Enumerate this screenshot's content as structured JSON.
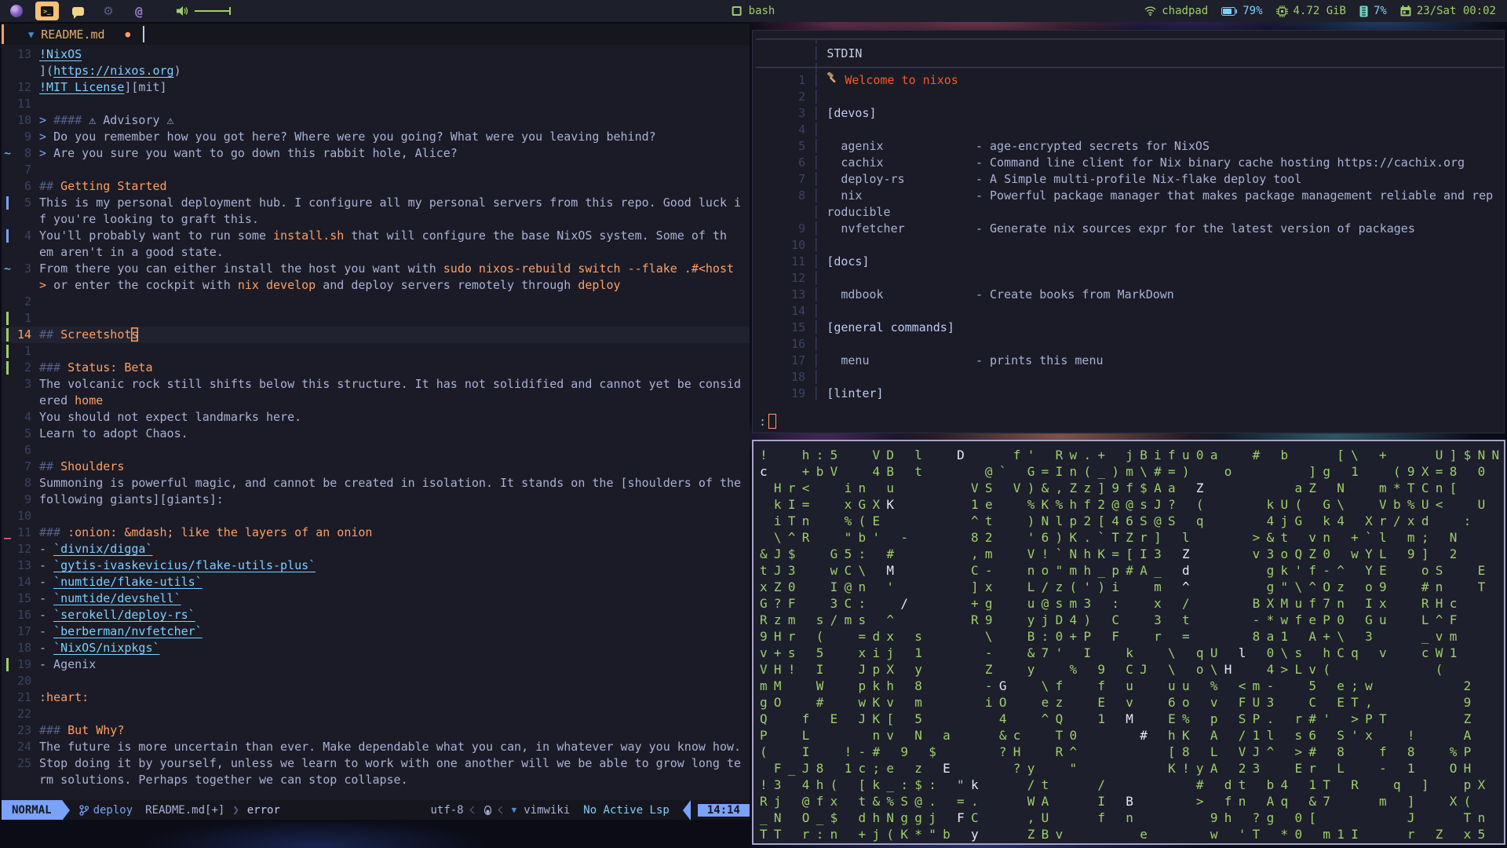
{
  "colors": {
    "accent_blue": "#7aa2f7",
    "accent_orange": "#ff9e64",
    "green": "#9ece6a",
    "cyan": "#7dcfff",
    "red_orange": "#f4582c",
    "matrix_green": "#9ece6a"
  },
  "topbar": {
    "apps": [
      {
        "id": "firefox",
        "active": false
      },
      {
        "id": "terminal",
        "active": true
      },
      {
        "id": "chat",
        "active": false
      },
      {
        "id": "settings",
        "active": false
      },
      {
        "id": "mentions",
        "active": false
      }
    ],
    "window_title": "bash",
    "tray": {
      "user": "chadpad",
      "battery_pct": "79%",
      "memory": "4.72 GiB",
      "cpu_pct": "7%",
      "clock": "23/Sat 00:02"
    }
  },
  "editor": {
    "tab": {
      "file": "README.md",
      "modified_dot": "●"
    },
    "statusline": {
      "mode": "NORMAL",
      "branch": "deploy",
      "file": "README.md[+]",
      "context": "error",
      "encoding": "utf-8",
      "filetype": "vimwiki",
      "lsp": "No Active Lsp",
      "time": "14:14"
    },
    "rows": [
      {
        "s": "",
        "n": "13",
        "seg": [
          [
            "link",
            "!NixOS"
          ]
        ]
      },
      {
        "s": "",
        "n": "",
        "seg": [
          [
            "txt",
            "]("
          ],
          [
            "link",
            "https://nixos.org"
          ],
          [
            "txt",
            ")"
          ]
        ]
      },
      {
        "s": "",
        "n": "12",
        "seg": [
          [
            "link",
            "!MIT License"
          ],
          [
            "txt",
            "][mit]"
          ]
        ]
      },
      {
        "s": "",
        "n": "11",
        "seg": []
      },
      {
        "s": "",
        "n": "10",
        "seg": [
          [
            "q",
            "> "
          ],
          [
            "hm",
            "#### "
          ],
          [
            "txt",
            "⚠ Advisory ⚠"
          ]
        ]
      },
      {
        "s": "",
        "n": "9",
        "seg": [
          [
            "q",
            "> "
          ],
          [
            "txt",
            "Do you remember how you got here? Where were you going? What were you leaving behind?"
          ]
        ]
      },
      {
        "s": "t",
        "n": "8",
        "seg": [
          [
            "q",
            "> "
          ],
          [
            "txt",
            "Are you sure you want to go down this rabbit hole, Alice?"
          ]
        ]
      },
      {
        "s": "",
        "n": "7",
        "seg": []
      },
      {
        "s": "",
        "n": "6",
        "seg": [
          [
            "hm",
            "## "
          ],
          [
            "h",
            "Getting Started"
          ]
        ]
      },
      {
        "s": "b",
        "n": "5",
        "seg": [
          [
            "txt",
            "This is my personal deployment hub. I configure all my personal servers from this repo. Good luck i"
          ]
        ]
      },
      {
        "s": "",
        "n": "",
        "seg": [
          [
            "txt",
            "f you're looking to graft this."
          ]
        ]
      },
      {
        "s": "b",
        "n": "4",
        "seg": [
          [
            "txt",
            "You'll probably want to run some "
          ],
          [
            "code",
            "install.sh"
          ],
          [
            "txt",
            " that will configure the base NixOS system. Some of th"
          ]
        ]
      },
      {
        "s": "",
        "n": "",
        "seg": [
          [
            "txt",
            "em aren't in a good state."
          ]
        ]
      },
      {
        "s": "t",
        "n": "3",
        "seg": [
          [
            "txt",
            "From there you can either install the host you want with "
          ],
          [
            "code",
            "sudo nixos-rebuild switch --flake .#<host"
          ]
        ]
      },
      {
        "s": "",
        "n": "",
        "seg": [
          [
            "wr",
            "> "
          ],
          [
            "txt",
            "or enter the cockpit with "
          ],
          [
            "code",
            "nix develop"
          ],
          [
            "txt",
            " and deploy servers remotely through "
          ],
          [
            "code",
            "deploy"
          ]
        ]
      },
      {
        "s": "",
        "n": "2",
        "seg": []
      },
      {
        "s": "g",
        "n": "1",
        "seg": []
      },
      {
        "s": "g",
        "n": "14",
        "cur": true,
        "seg": [
          [
            "hm",
            "## "
          ],
          [
            "h",
            "Screetshot"
          ],
          [
            "cu",
            "s"
          ]
        ]
      },
      {
        "s": "g",
        "n": "1",
        "seg": []
      },
      {
        "s": "g",
        "n": "2",
        "seg": [
          [
            "hm",
            "### "
          ],
          [
            "h",
            "Status: Beta"
          ]
        ]
      },
      {
        "s": "",
        "n": "3",
        "seg": [
          [
            "txt",
            "The volcanic rock still shifts below this structure. It has not solidified and cannot yet be consid"
          ]
        ]
      },
      {
        "s": "",
        "n": "",
        "seg": [
          [
            "txt",
            "ered "
          ],
          [
            "code",
            "home"
          ]
        ]
      },
      {
        "s": "",
        "n": "4",
        "seg": [
          [
            "txt",
            "You should not expect landmarks here."
          ]
        ]
      },
      {
        "s": "",
        "n": "5",
        "seg": [
          [
            "txt",
            "Learn to adopt Chaos."
          ]
        ]
      },
      {
        "s": "",
        "n": "6",
        "seg": []
      },
      {
        "s": "",
        "n": "7",
        "seg": [
          [
            "hm",
            "## "
          ],
          [
            "h",
            "Shoulders"
          ]
        ]
      },
      {
        "s": "",
        "n": "8",
        "seg": [
          [
            "txt",
            "Summoning is powerful magic, and cannot be created in isolation. It stands on the [shoulders of the"
          ]
        ]
      },
      {
        "s": "",
        "n": "9",
        "seg": [
          [
            "txt",
            "following giants][giants]:"
          ]
        ]
      },
      {
        "s": "",
        "n": "10",
        "seg": []
      },
      {
        "s": "r",
        "n": "11",
        "seg": [
          [
            "hm",
            "### "
          ],
          [
            "h",
            ":onion: &mdash; like the layers of an onion"
          ]
        ]
      },
      {
        "s": "",
        "n": "12",
        "seg": [
          [
            "txt",
            "- "
          ],
          [
            "link",
            "`divnix/digga`"
          ]
        ]
      },
      {
        "s": "",
        "n": "13",
        "seg": [
          [
            "txt",
            "- "
          ],
          [
            "link",
            "`gytis-ivaskevicius/flake-utils-plus`"
          ]
        ]
      },
      {
        "s": "",
        "n": "14",
        "seg": [
          [
            "txt",
            "- "
          ],
          [
            "link",
            "`numtide/flake-utils`"
          ]
        ]
      },
      {
        "s": "",
        "n": "15",
        "seg": [
          [
            "txt",
            "- "
          ],
          [
            "link",
            "`numtide/devshell`"
          ]
        ]
      },
      {
        "s": "",
        "n": "16",
        "seg": [
          [
            "txt",
            "- "
          ],
          [
            "link",
            "`serokell/deploy-rs`"
          ]
        ]
      },
      {
        "s": "",
        "n": "17",
        "seg": [
          [
            "txt",
            "- "
          ],
          [
            "link",
            "`berberman/nvfetcher`"
          ]
        ]
      },
      {
        "s": "",
        "n": "18",
        "seg": [
          [
            "txt",
            "- "
          ],
          [
            "link",
            "`NixOS/nixpkgs`"
          ]
        ]
      },
      {
        "s": "g",
        "n": "19",
        "seg": [
          [
            "txt",
            "- Agenix"
          ]
        ]
      },
      {
        "s": "",
        "n": "20",
        "seg": []
      },
      {
        "s": "",
        "n": "21",
        "seg": [
          [
            "code",
            ":heart:"
          ]
        ]
      },
      {
        "s": "",
        "n": "22",
        "seg": []
      },
      {
        "s": "",
        "n": "23",
        "seg": [
          [
            "hm",
            "### "
          ],
          [
            "h",
            "But Why?"
          ]
        ]
      },
      {
        "s": "",
        "n": "24",
        "seg": [
          [
            "txt",
            "The future is more uncertain than ever. Make dependable what you can, in whatever way you know how."
          ]
        ]
      },
      {
        "s": "",
        "n": "25",
        "seg": [
          [
            "txt",
            "Stop doing it by yourself, unless we learn to work with one another will we be able to grow long te"
          ]
        ]
      },
      {
        "s": "",
        "n": "",
        "seg": [
          [
            "txt",
            "rm solutions. Perhaps together we can stop collapse."
          ]
        ]
      }
    ]
  },
  "pager": {
    "title": "STDIN",
    "prompt": ":",
    "lines": [
      {
        "n": "1",
        "icon": "hammer",
        "seg": [
          [
            "w",
            "Welcome to nixos"
          ]
        ]
      },
      {
        "n": "2",
        "seg": []
      },
      {
        "n": "3",
        "seg": [
          [
            "b",
            "[devos]"
          ]
        ]
      },
      {
        "n": "4",
        "seg": []
      },
      {
        "n": "5",
        "seg": [
          [
            "t",
            "  agenix             - age-encrypted secrets for NixOS"
          ]
        ]
      },
      {
        "n": "6",
        "seg": [
          [
            "t",
            "  cachix             - Command line client for Nix binary cache hosting https://cachix.org"
          ]
        ]
      },
      {
        "n": "7",
        "seg": [
          [
            "t",
            "  deploy-rs          - A Simple multi-profile Nix-flake deploy tool"
          ]
        ]
      },
      {
        "n": "8",
        "seg": [
          [
            "t",
            "  nix                - Powerful package manager that makes package management reliable and rep"
          ]
        ]
      },
      {
        "n": "",
        "seg": [
          [
            "t",
            "roducible"
          ]
        ]
      },
      {
        "n": "9",
        "seg": [
          [
            "t",
            "  nvfetcher          - Generate nix sources expr for the latest version of packages"
          ]
        ]
      },
      {
        "n": "10",
        "seg": []
      },
      {
        "n": "11",
        "seg": [
          [
            "b",
            "[docs]"
          ]
        ]
      },
      {
        "n": "12",
        "seg": []
      },
      {
        "n": "13",
        "seg": [
          [
            "t",
            "  mdbook             - Create books from MarkDown"
          ]
        ]
      },
      {
        "n": "14",
        "seg": []
      },
      {
        "n": "15",
        "seg": [
          [
            "b",
            "[general commands]"
          ]
        ]
      },
      {
        "n": "16",
        "seg": []
      },
      {
        "n": "17",
        "seg": [
          [
            "t",
            "  menu               - prints this menu"
          ]
        ]
      },
      {
        "n": "18",
        "seg": []
      },
      {
        "n": "19",
        "seg": [
          [
            "b",
            "[linter]"
          ]
        ]
      }
    ]
  },
  "matrix": {
    "rows": [
      "!  h:5  VD l  D   f' Rw.+ jBifu0a  # b   [\\ +   U]$NN",
      "c  +bV  4B t    @` G=In(_)m\\#=)  o     ]g 1  (9X=8 0",
      " Hr<  in u     VS V)&,Zz]9f$Aa Z      aZ N  m*TCn[  ",
      " kI=  xGXK     1e  %K%hf2@@sJ? (    kU( G\\  Vb%U<  U",
      " iTn  %(E      ^t  )Nlp2[46S@S q    4jG k4 Xr/xd  : ",
      " \\^R  \"b' -    82  '6)K.`TZr] l    >&t vn +`l m; N",
      "&J$  G5: #     ,m  V!`NhK=[I3 Z    v3oQZ0 wYL 9] 2 ",
      "tJ3  wC\\ M     C-  no\"mh_p#A_ d     gk'f-^ YE  oS  E",
      "xZ0  I@n '     ]x  L/z(')i  m ^     g\"\\^Oz o9  #n  T",
      "G?F  3C:  /    +g  u@sm3 :  x /    BXMuf7n Ix  RHc  ",
      "Rzm s/ms ^     R9  yjD4) C  3 t    -*wfeP0 Gu  L^F  ",
      "9Hr (  =dx s    \\  B:0+P F  r =    8a1 A+\\ 3   _vm  ",
      "v+s 5  xij 1    -  &7' I  k  \\ qU l 0\\s hCq v  cW1  ",
      "VH! I  JpX y    Z  y  % 9 CJ \\ o\\H  4>Lv(       (   ",
      "mM  W  pkh 8    -G  \\f  f u  uu % <m-  5 e;w      2 ",
      "gO  #  wKv m    iO  ez  E v  6o v FU3  C ET,      9 ",
      "Q  f E JK[ 5     4  ^Q  1 M  E% p SP. r#' >PT     Z ",
      "P  L    nv N a   &c  T0    # hK A /1l s6 S'x  !   A ",
      "(  I  !-# 9 $    ?H  R^      [8 L VJ^ ># 8  f 8  %P ",
      " F_J8 1c;e z E    ?y  \"      K!yA 23  Er L  - 1  OH ",
      "!3 4h( [k_:$: \"k   /t   /      # dt b4 1T R  q ]  pX",
      "Rj @fx t&%S@. =.   WA   I B    > fn Aq &7   m ]  X( ",
      "_N O_$ dhNggj FC   ,U   f n     9h ?g 0[      J   Tn",
      "TT r:n +j(K*\"b y   ZBv     e    w 'T *0 m1I   r Z x5"
    ],
    "bright": [
      [
        0,
        14
      ],
      [
        1,
        0
      ],
      [
        1,
        34
      ],
      [
        2,
        31
      ],
      [
        3,
        9
      ],
      [
        5,
        31
      ],
      [
        6,
        30
      ],
      [
        7,
        9
      ],
      [
        7,
        30
      ],
      [
        8,
        30
      ],
      [
        9,
        10
      ],
      [
        12,
        34
      ],
      [
        13,
        33
      ],
      [
        14,
        17
      ],
      [
        16,
        26
      ],
      [
        17,
        27
      ],
      [
        19,
        13
      ],
      [
        20,
        15
      ],
      [
        21,
        26
      ],
      [
        22,
        14
      ],
      [
        23,
        15
      ]
    ]
  }
}
